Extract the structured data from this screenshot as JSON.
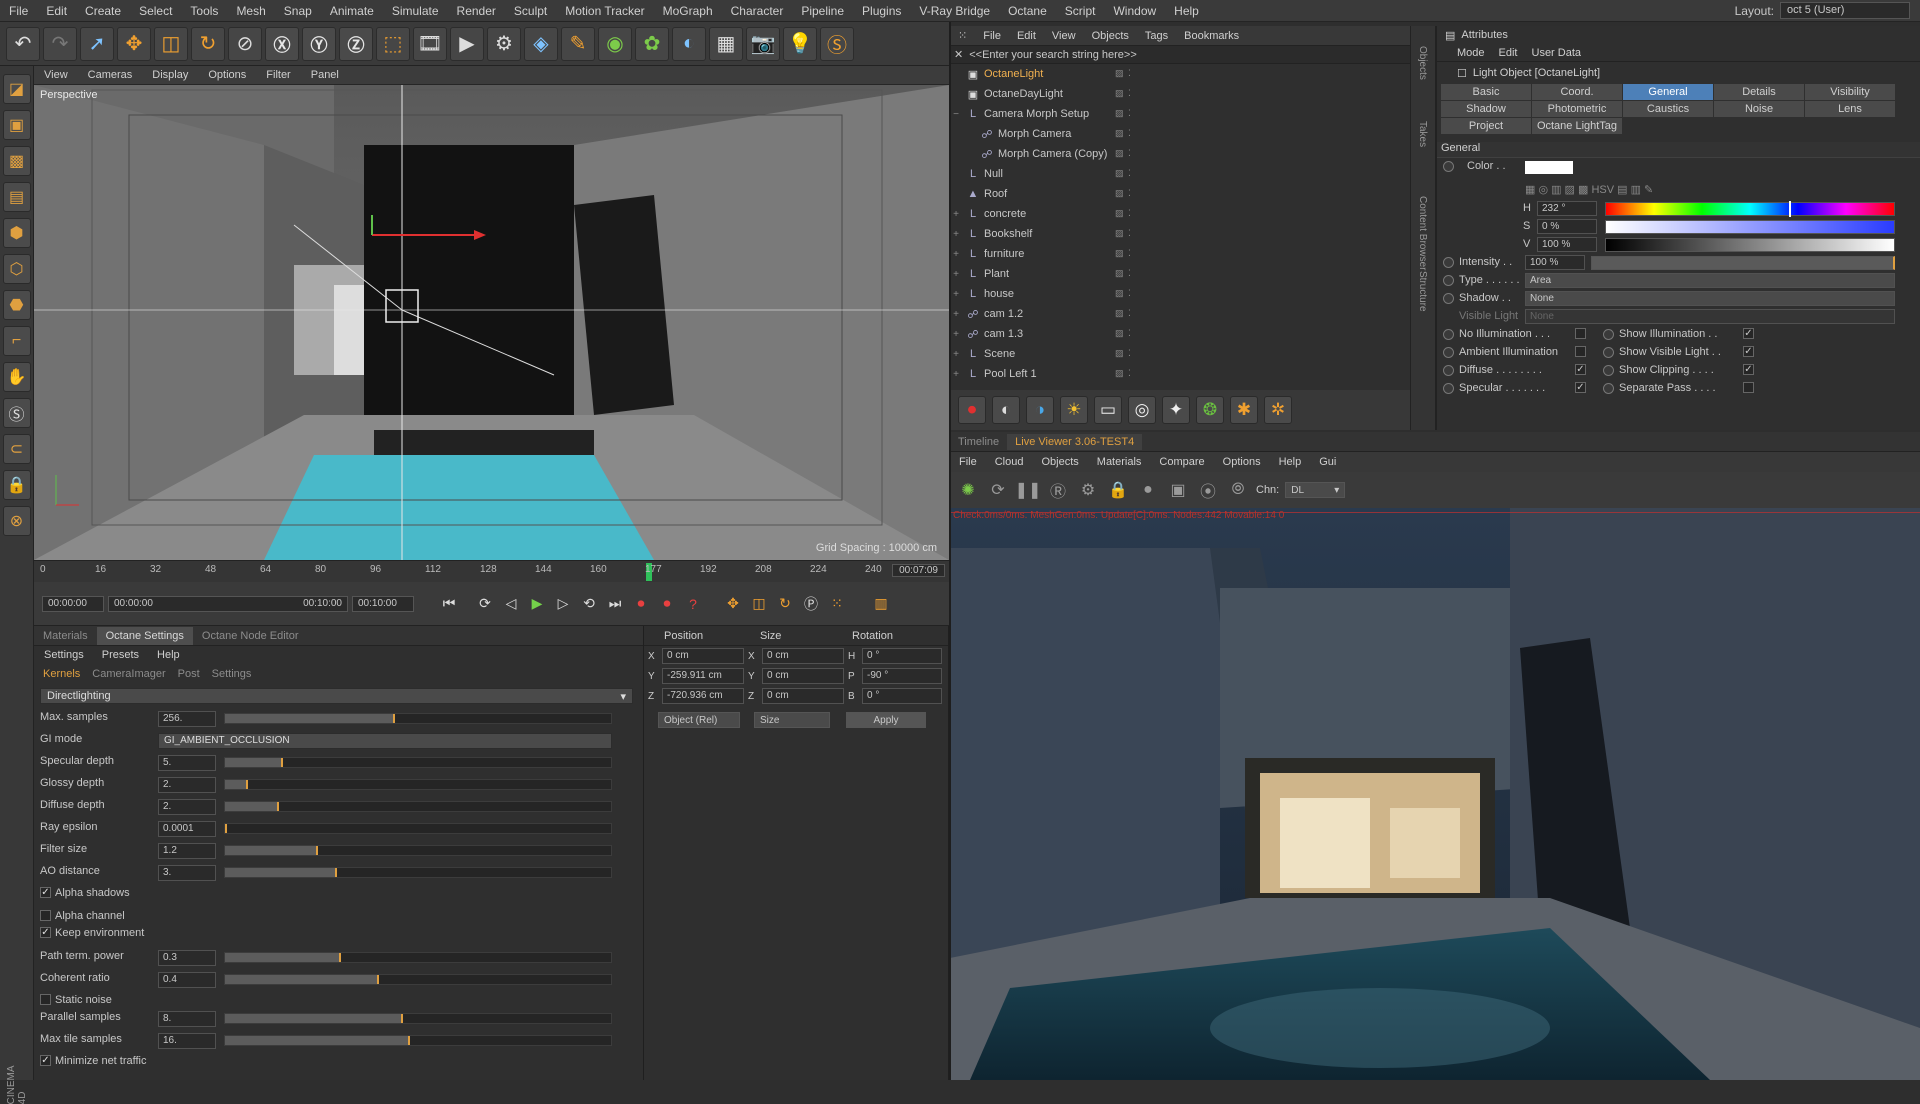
{
  "menubar": {
    "items": [
      "File",
      "Edit",
      "Create",
      "Select",
      "Tools",
      "Mesh",
      "Snap",
      "Animate",
      "Simulate",
      "Render",
      "Sculpt",
      "Motion Tracker",
      "MoGraph",
      "Character",
      "Pipeline",
      "Plugins",
      "V-Ray Bridge",
      "Octane",
      "Script",
      "Window",
      "Help"
    ],
    "layout_label": "Layout:",
    "layout_value": "oct 5 (User)"
  },
  "viewport": {
    "menu": [
      "View",
      "Cameras",
      "Display",
      "Options",
      "Filter",
      "Panel"
    ],
    "label": "Perspective",
    "grid_spacing": "Grid Spacing : 10000 cm"
  },
  "timeline": {
    "ticks": [
      "0",
      "16",
      "32",
      "48",
      "64",
      "80",
      "96",
      "112",
      "128",
      "144",
      "160",
      "177",
      "192",
      "208",
      "224",
      "240"
    ],
    "current_time": "00:07:09",
    "field_start": "00:00:00",
    "field_mid_start": "00:00:00",
    "field_mid_end": "00:10:00",
    "field_end": "00:10:00"
  },
  "octane_settings": {
    "tabs": [
      "Materials",
      "Octane Settings",
      "Octane Node Editor"
    ],
    "menu": [
      "Settings",
      "Presets",
      "Help"
    ],
    "subtabs": [
      "Kernels",
      "CameraImager",
      "Post",
      "Settings"
    ],
    "kernel": "Directlighting",
    "params": [
      {
        "label": "Max. samples",
        "value": "256.",
        "fill": 0.44
      },
      {
        "label": "GI mode",
        "value": "GI_AMBIENT_OCCLUSION"
      },
      {
        "label": "Specular depth",
        "value": "5.",
        "fill": 0.15
      },
      {
        "label": "Glossy depth",
        "value": "2.",
        "fill": 0.06
      },
      {
        "label": "Diffuse depth",
        "value": "2.",
        "fill": 0.14
      },
      {
        "label": "Ray epsilon",
        "value": "0.0001",
        "fill": 0.0
      },
      {
        "label": "Filter size",
        "value": "1.2",
        "fill": 0.24
      },
      {
        "label": "AO distance",
        "value": "3.",
        "fill": 0.29
      }
    ],
    "checks1": [
      {
        "label": "Alpha shadows",
        "checked": true
      }
    ],
    "checks2": [
      {
        "label": "Alpha channel",
        "checked": false
      },
      {
        "label": "Keep environment",
        "checked": true
      }
    ],
    "params2": [
      {
        "label": "Path term. power",
        "value": "0.3",
        "fill": 0.3
      },
      {
        "label": "Coherent ratio",
        "value": "0.4",
        "fill": 0.4
      }
    ],
    "checks3": [
      {
        "label": "Static noise",
        "checked": false
      }
    ],
    "params3": [
      {
        "label": "Parallel samples",
        "value": "8.",
        "fill": 0.46
      },
      {
        "label": "Max tile samples",
        "value": "16.",
        "fill": 0.48
      }
    ],
    "checks4": [
      {
        "label": "Minimize net traffic",
        "checked": true
      }
    ]
  },
  "coords": {
    "headers": [
      "Position",
      "Size",
      "Rotation"
    ],
    "rows": [
      {
        "a1": "X",
        "p": "0 cm",
        "a2": "X",
        "s": "0 cm",
        "a3": "H",
        "r": "0 °"
      },
      {
        "a1": "Y",
        "p": "-259.911 cm",
        "a2": "Y",
        "s": "0 cm",
        "a3": "P",
        "r": "-90 °"
      },
      {
        "a1": "Z",
        "p": "-720.936 cm",
        "a2": "Z",
        "s": "0 cm",
        "a3": "B",
        "r": "0 °"
      }
    ],
    "mode": "Object (Rel)",
    "size_mode": "Size",
    "apply": "Apply"
  },
  "objects": {
    "menu": [
      "File",
      "Edit",
      "View",
      "Objects",
      "Tags",
      "Bookmarks"
    ],
    "search": "<<Enter your search string here>>",
    "items": [
      {
        "name": "OctaneLight",
        "selected": true,
        "expand": "",
        "icon": "light"
      },
      {
        "name": "OctaneDayLight",
        "selected": false,
        "expand": "",
        "icon": "light"
      },
      {
        "name": "Camera Morph Setup",
        "selected": false,
        "expand": "−",
        "icon": "null"
      },
      {
        "name": "Morph Camera",
        "selected": false,
        "expand": "",
        "icon": "camera",
        "indent": true
      },
      {
        "name": "Morph Camera (Copy)",
        "selected": false,
        "expand": "",
        "icon": "camera",
        "indent": true
      },
      {
        "name": "Null",
        "selected": false,
        "expand": "",
        "icon": "null"
      },
      {
        "name": "Roof",
        "selected": false,
        "expand": "",
        "icon": "mesh"
      },
      {
        "name": "concrete",
        "selected": false,
        "expand": "+",
        "icon": "null"
      },
      {
        "name": "Bookshelf",
        "selected": false,
        "expand": "+",
        "icon": "null"
      },
      {
        "name": "furniture",
        "selected": false,
        "expand": "+",
        "icon": "null"
      },
      {
        "name": "Plant",
        "selected": false,
        "expand": "+",
        "icon": "null"
      },
      {
        "name": "house",
        "selected": false,
        "expand": "+",
        "icon": "null"
      },
      {
        "name": "cam 1.2",
        "selected": false,
        "expand": "+",
        "icon": "camera"
      },
      {
        "name": "cam 1.3",
        "selected": false,
        "expand": "+",
        "icon": "camera"
      },
      {
        "name": "Scene",
        "selected": false,
        "expand": "+",
        "icon": "null"
      },
      {
        "name": "Pool Left 1",
        "selected": false,
        "expand": "+",
        "icon": "null"
      }
    ]
  },
  "live_viewer": {
    "tabs": [
      "Timeline",
      "Live Viewer 3.06-TEST4"
    ],
    "menu": [
      "File",
      "Cloud",
      "Objects",
      "Materials",
      "Compare",
      "Options",
      "Help",
      "Gui"
    ],
    "chn_label": "Chn:",
    "chn_value": "DL",
    "status": "Check:0ms/0ms. MeshGen:0ms. Update[C]:0ms. Nodes:442 Movable:14  0"
  },
  "attributes": {
    "title": "Attributes",
    "menu": [
      "Mode",
      "Edit",
      "User Data"
    ],
    "object": "Light Object [OctaneLight]",
    "tabs": [
      "Basic",
      "Coord.",
      "General",
      "Details",
      "Visibility",
      "Shadow",
      "Photometric",
      "Caustics",
      "Noise",
      "Lens",
      "Project",
      "Octane LightTag"
    ],
    "section": "General",
    "color_label": "Color . .",
    "h": "232 °",
    "s": "0 %",
    "v": "100 %",
    "intensity_label": "Intensity . .",
    "intensity": "100 %",
    "type_label": "Type . . . . . .",
    "type": "Area",
    "shadow_label": "Shadow . .",
    "shadow": "None",
    "vis_label": "Visible Light",
    "vis": "None",
    "flags_left": [
      {
        "label": "No Illumination . . .",
        "checked": false
      },
      {
        "label": "Ambient Illumination",
        "checked": false
      },
      {
        "label": "Diffuse . . . . . . . .",
        "checked": true
      },
      {
        "label": "Specular . . . . . . .",
        "checked": true
      }
    ],
    "flags_right": [
      {
        "label": "Show Illumination . .",
        "checked": true
      },
      {
        "label": "Show Visible Light . .",
        "checked": true
      },
      {
        "label": "Show Clipping . . . .",
        "checked": true
      },
      {
        "label": "Separate Pass . . . .",
        "checked": false
      }
    ]
  },
  "side_tabs": [
    "Objects",
    "Takes",
    "Content Browser",
    "Structure"
  ],
  "c4d_label": "CINEMA 4D"
}
